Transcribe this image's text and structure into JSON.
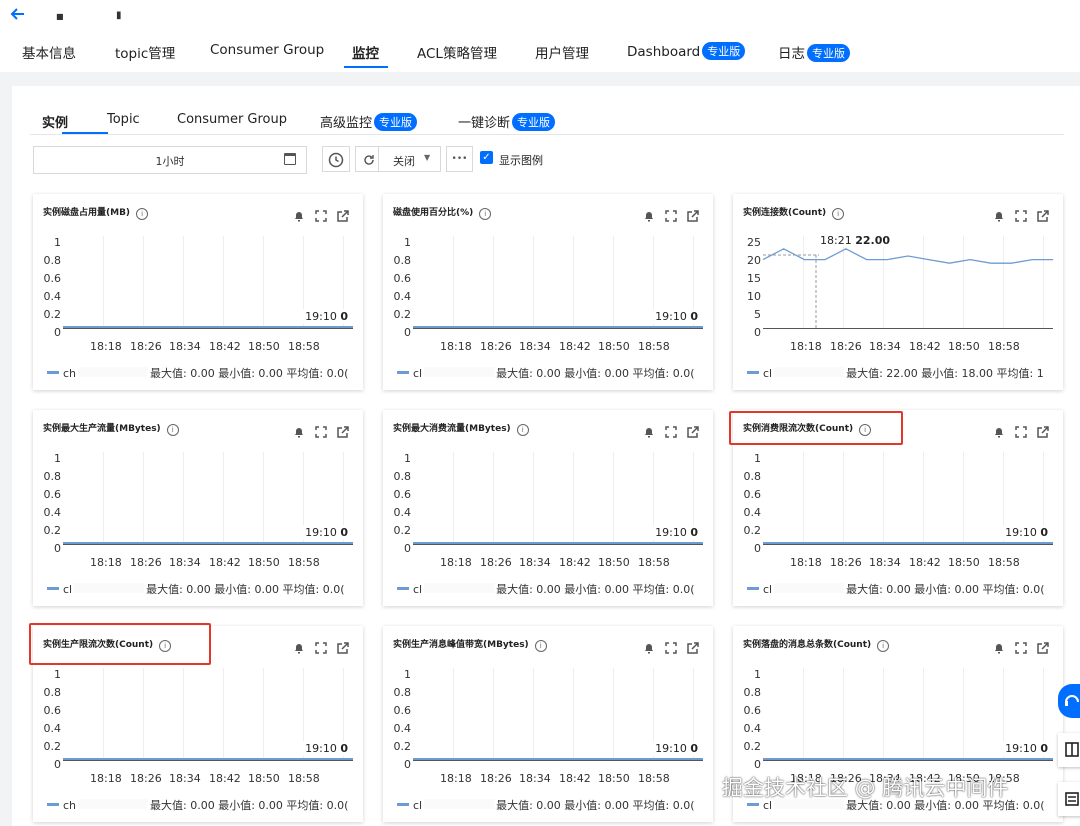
{
  "header": {
    "back_icon": "arrow-left-icon",
    "instance_name_1": "■",
    "instance_name_2": "▮",
    "tabs": [
      {
        "label": "基本信息"
      },
      {
        "label": "topic管理"
      },
      {
        "label": "Consumer Group"
      },
      {
        "label": "监控",
        "active": true
      },
      {
        "label": "ACL策略管理"
      },
      {
        "label": "用户管理"
      },
      {
        "label": "Dashboard",
        "badge": "专业版"
      },
      {
        "label": "日志",
        "badge": "专业版"
      }
    ]
  },
  "subtabs": [
    {
      "label": "实例",
      "active": true
    },
    {
      "label": "Topic"
    },
    {
      "label": "Consumer Group"
    },
    {
      "label": "高级监控",
      "badge": "专业版"
    },
    {
      "label": "一键诊断",
      "badge": "专业版"
    }
  ],
  "toolbar": {
    "time_range": "1小时",
    "refresh_label": "关闭",
    "more_label": "•••",
    "show_legend_label": "显示图例",
    "show_legend_checked": true
  },
  "accent_color": "#006eff",
  "highlight_color": "#e0382b",
  "series_color": "#6d9cd3",
  "charts": [
    {
      "title": "实例磁盘占用量(MB)",
      "yticks": [
        "1",
        "0.8",
        "0.6",
        "0.4",
        "0.2",
        "0"
      ],
      "xticks": [
        "18:18",
        "18:26",
        "18:34",
        "18:42",
        "18:50",
        "18:58"
      ],
      "last_time": "19:10",
      "last_value": "0",
      "legend_name": "ch",
      "legend_stats": "最大值: 0.00  最小值: 0.00  平均值: 0.0(",
      "highlighted": false
    },
    {
      "title": "磁盘使用百分比(%)",
      "yticks": [
        "1",
        "0.8",
        "0.6",
        "0.4",
        "0.2",
        "0"
      ],
      "xticks": [
        "18:18",
        "18:26",
        "18:34",
        "18:42",
        "18:50",
        "18:58"
      ],
      "last_time": "19:10",
      "last_value": "0",
      "legend_name": "cl",
      "legend_stats": "最大值: 0.00  最小值: 0.00  平均值: 0.0(",
      "highlighted": false
    },
    {
      "title": "实例连接数(Count)",
      "yticks": [
        "25",
        "20",
        "15",
        "10",
        "5",
        "0"
      ],
      "xticks": [
        "18:18",
        "18:26",
        "18:34",
        "18:42",
        "18:50",
        "18:58"
      ],
      "tooltip_time": "18:21",
      "tooltip_value": "22.00",
      "legend_name": "cl",
      "legend_stats": "最大值: 22.00  最小值: 18.00  平均值: 1",
      "highlighted": false
    },
    {
      "title": "实例最大生产流量(MBytes)",
      "yticks": [
        "1",
        "0.8",
        "0.6",
        "0.4",
        "0.2",
        "0"
      ],
      "xticks": [
        "18:18",
        "18:26",
        "18:34",
        "18:42",
        "18:50",
        "18:58"
      ],
      "last_time": "19:10",
      "last_value": "0",
      "legend_name": "cl",
      "legend_stats": "最大值: 0.00  最小值: 0.00  平均值: 0.0(",
      "highlighted": false
    },
    {
      "title": "实例最大消费流量(MBytes)",
      "yticks": [
        "1",
        "0.8",
        "0.6",
        "0.4",
        "0.2",
        "0"
      ],
      "xticks": [
        "18:18",
        "18:26",
        "18:34",
        "18:42",
        "18:50",
        "18:58"
      ],
      "last_time": "19:10",
      "last_value": "0",
      "legend_name": "cl",
      "legend_stats": "最大值: 0.00  最小值: 0.00  平均值: 0.0(",
      "highlighted": false
    },
    {
      "title": "实例消费限流次数(Count)",
      "yticks": [
        "1",
        "0.8",
        "0.6",
        "0.4",
        "0.2",
        "0"
      ],
      "xticks": [
        "18:18",
        "18:26",
        "18:34",
        "18:42",
        "18:50",
        "18:58"
      ],
      "last_time": "19:10",
      "last_value": "0",
      "legend_name": "cl",
      "legend_stats": "最大值: 0.00  最小值: 0.00  平均值: 0.0(",
      "highlighted": true
    },
    {
      "title": "实例生产限流次数(Count)",
      "yticks": [
        "1",
        "0.8",
        "0.6",
        "0.4",
        "0.2",
        "0"
      ],
      "xticks": [
        "18:18",
        "18:26",
        "18:34",
        "18:42",
        "18:50",
        "18:58"
      ],
      "last_time": "19:10",
      "last_value": "0",
      "legend_name": "ch",
      "legend_stats": "最大值: 0.00  最小值: 0.00  平均值: 0.0(",
      "highlighted": true
    },
    {
      "title": "实例生产消息峰值带宽(MBytes)",
      "yticks": [
        "1",
        "0.8",
        "0.6",
        "0.4",
        "0.2",
        "0"
      ],
      "xticks": [
        "18:18",
        "18:26",
        "18:34",
        "18:42",
        "18:50",
        "18:58"
      ],
      "last_time": "19:10",
      "last_value": "0",
      "legend_name": "cl",
      "legend_stats": "最大值: 0.00  最小值: 0.00  平均值: 0.0(",
      "highlighted": false
    },
    {
      "title": "实例落盘的消息总条数(Count)",
      "yticks": [
        "1",
        "0.8",
        "0.6",
        "0.4",
        "0.2",
        "0"
      ],
      "xticks": [
        "18:18",
        "18:26",
        "18:34",
        "18:42",
        "18:50",
        "18:58"
      ],
      "last_time": "19:10",
      "last_value": "0",
      "legend_name": "cl",
      "legend_stats": "最大值: 0.00  最小值: 0.00  平均值: 0.0(",
      "highlighted": false
    }
  ],
  "chart_data": [
    {
      "type": "line",
      "title": "实例磁盘占用量(MB)",
      "categories": [
        "18:18",
        "18:26",
        "18:34",
        "18:42",
        "18:50",
        "18:58",
        "19:10"
      ],
      "series": [
        {
          "values": [
            0,
            0,
            0,
            0,
            0,
            0,
            0
          ]
        }
      ],
      "ylim": [
        0,
        1
      ]
    },
    {
      "type": "line",
      "title": "磁盘使用百分比(%)",
      "categories": [
        "18:18",
        "18:26",
        "18:34",
        "18:42",
        "18:50",
        "18:58",
        "19:10"
      ],
      "series": [
        {
          "values": [
            0,
            0,
            0,
            0,
            0,
            0,
            0
          ]
        }
      ],
      "ylim": [
        0,
        1
      ]
    },
    {
      "type": "line",
      "title": "实例连接数(Count)",
      "x": [
        "18:11",
        "18:13",
        "18:15",
        "18:18",
        "18:21",
        "18:23",
        "18:26",
        "18:28",
        "18:31",
        "18:34",
        "18:42",
        "18:50",
        "18:58",
        "19:04",
        "19:10"
      ],
      "series": [
        {
          "values": [
            19,
            22,
            19,
            19,
            22,
            19,
            19,
            20,
            19,
            18,
            19,
            18,
            18,
            19,
            19
          ]
        }
      ],
      "ylim": [
        0,
        25
      ]
    },
    {
      "type": "line",
      "title": "实例最大生产流量(MBytes)",
      "categories": [
        "18:18",
        "18:26",
        "18:34",
        "18:42",
        "18:50",
        "18:58",
        "19:10"
      ],
      "series": [
        {
          "values": [
            0,
            0,
            0,
            0,
            0,
            0,
            0
          ]
        }
      ],
      "ylim": [
        0,
        1
      ]
    },
    {
      "type": "line",
      "title": "实例最大消费流量(MBytes)",
      "categories": [
        "18:18",
        "18:26",
        "18:34",
        "18:42",
        "18:50",
        "18:58",
        "19:10"
      ],
      "series": [
        {
          "values": [
            0,
            0,
            0,
            0,
            0,
            0,
            0
          ]
        }
      ],
      "ylim": [
        0,
        1
      ]
    },
    {
      "type": "line",
      "title": "实例消费限流次数(Count)",
      "categories": [
        "18:18",
        "18:26",
        "18:34",
        "18:42",
        "18:50",
        "18:58",
        "19:10"
      ],
      "series": [
        {
          "values": [
            0,
            0,
            0,
            0,
            0,
            0,
            0
          ]
        }
      ],
      "ylim": [
        0,
        1
      ]
    },
    {
      "type": "line",
      "title": "实例生产限流次数(Count)",
      "categories": [
        "18:18",
        "18:26",
        "18:34",
        "18:42",
        "18:50",
        "18:58",
        "19:10"
      ],
      "series": [
        {
          "values": [
            0,
            0,
            0,
            0,
            0,
            0,
            0
          ]
        }
      ],
      "ylim": [
        0,
        1
      ]
    },
    {
      "type": "line",
      "title": "实例生产消息峰值带宽(MBytes)",
      "categories": [
        "18:18",
        "18:26",
        "18:34",
        "18:42",
        "18:50",
        "18:58",
        "19:10"
      ],
      "series": [
        {
          "values": [
            0,
            0,
            0,
            0,
            0,
            0,
            0
          ]
        }
      ],
      "ylim": [
        0,
        1
      ]
    },
    {
      "type": "line",
      "title": "实例落盘的消息总条数(Count)",
      "categories": [
        "18:18",
        "18:26",
        "18:34",
        "18:42",
        "18:50",
        "18:58",
        "19:10"
      ],
      "series": [
        {
          "values": [
            0,
            0,
            0,
            0,
            0,
            0,
            0
          ]
        }
      ],
      "ylim": [
        0,
        1
      ]
    }
  ],
  "watermark": "掘金技术社区 @ 腾讯云中间件"
}
